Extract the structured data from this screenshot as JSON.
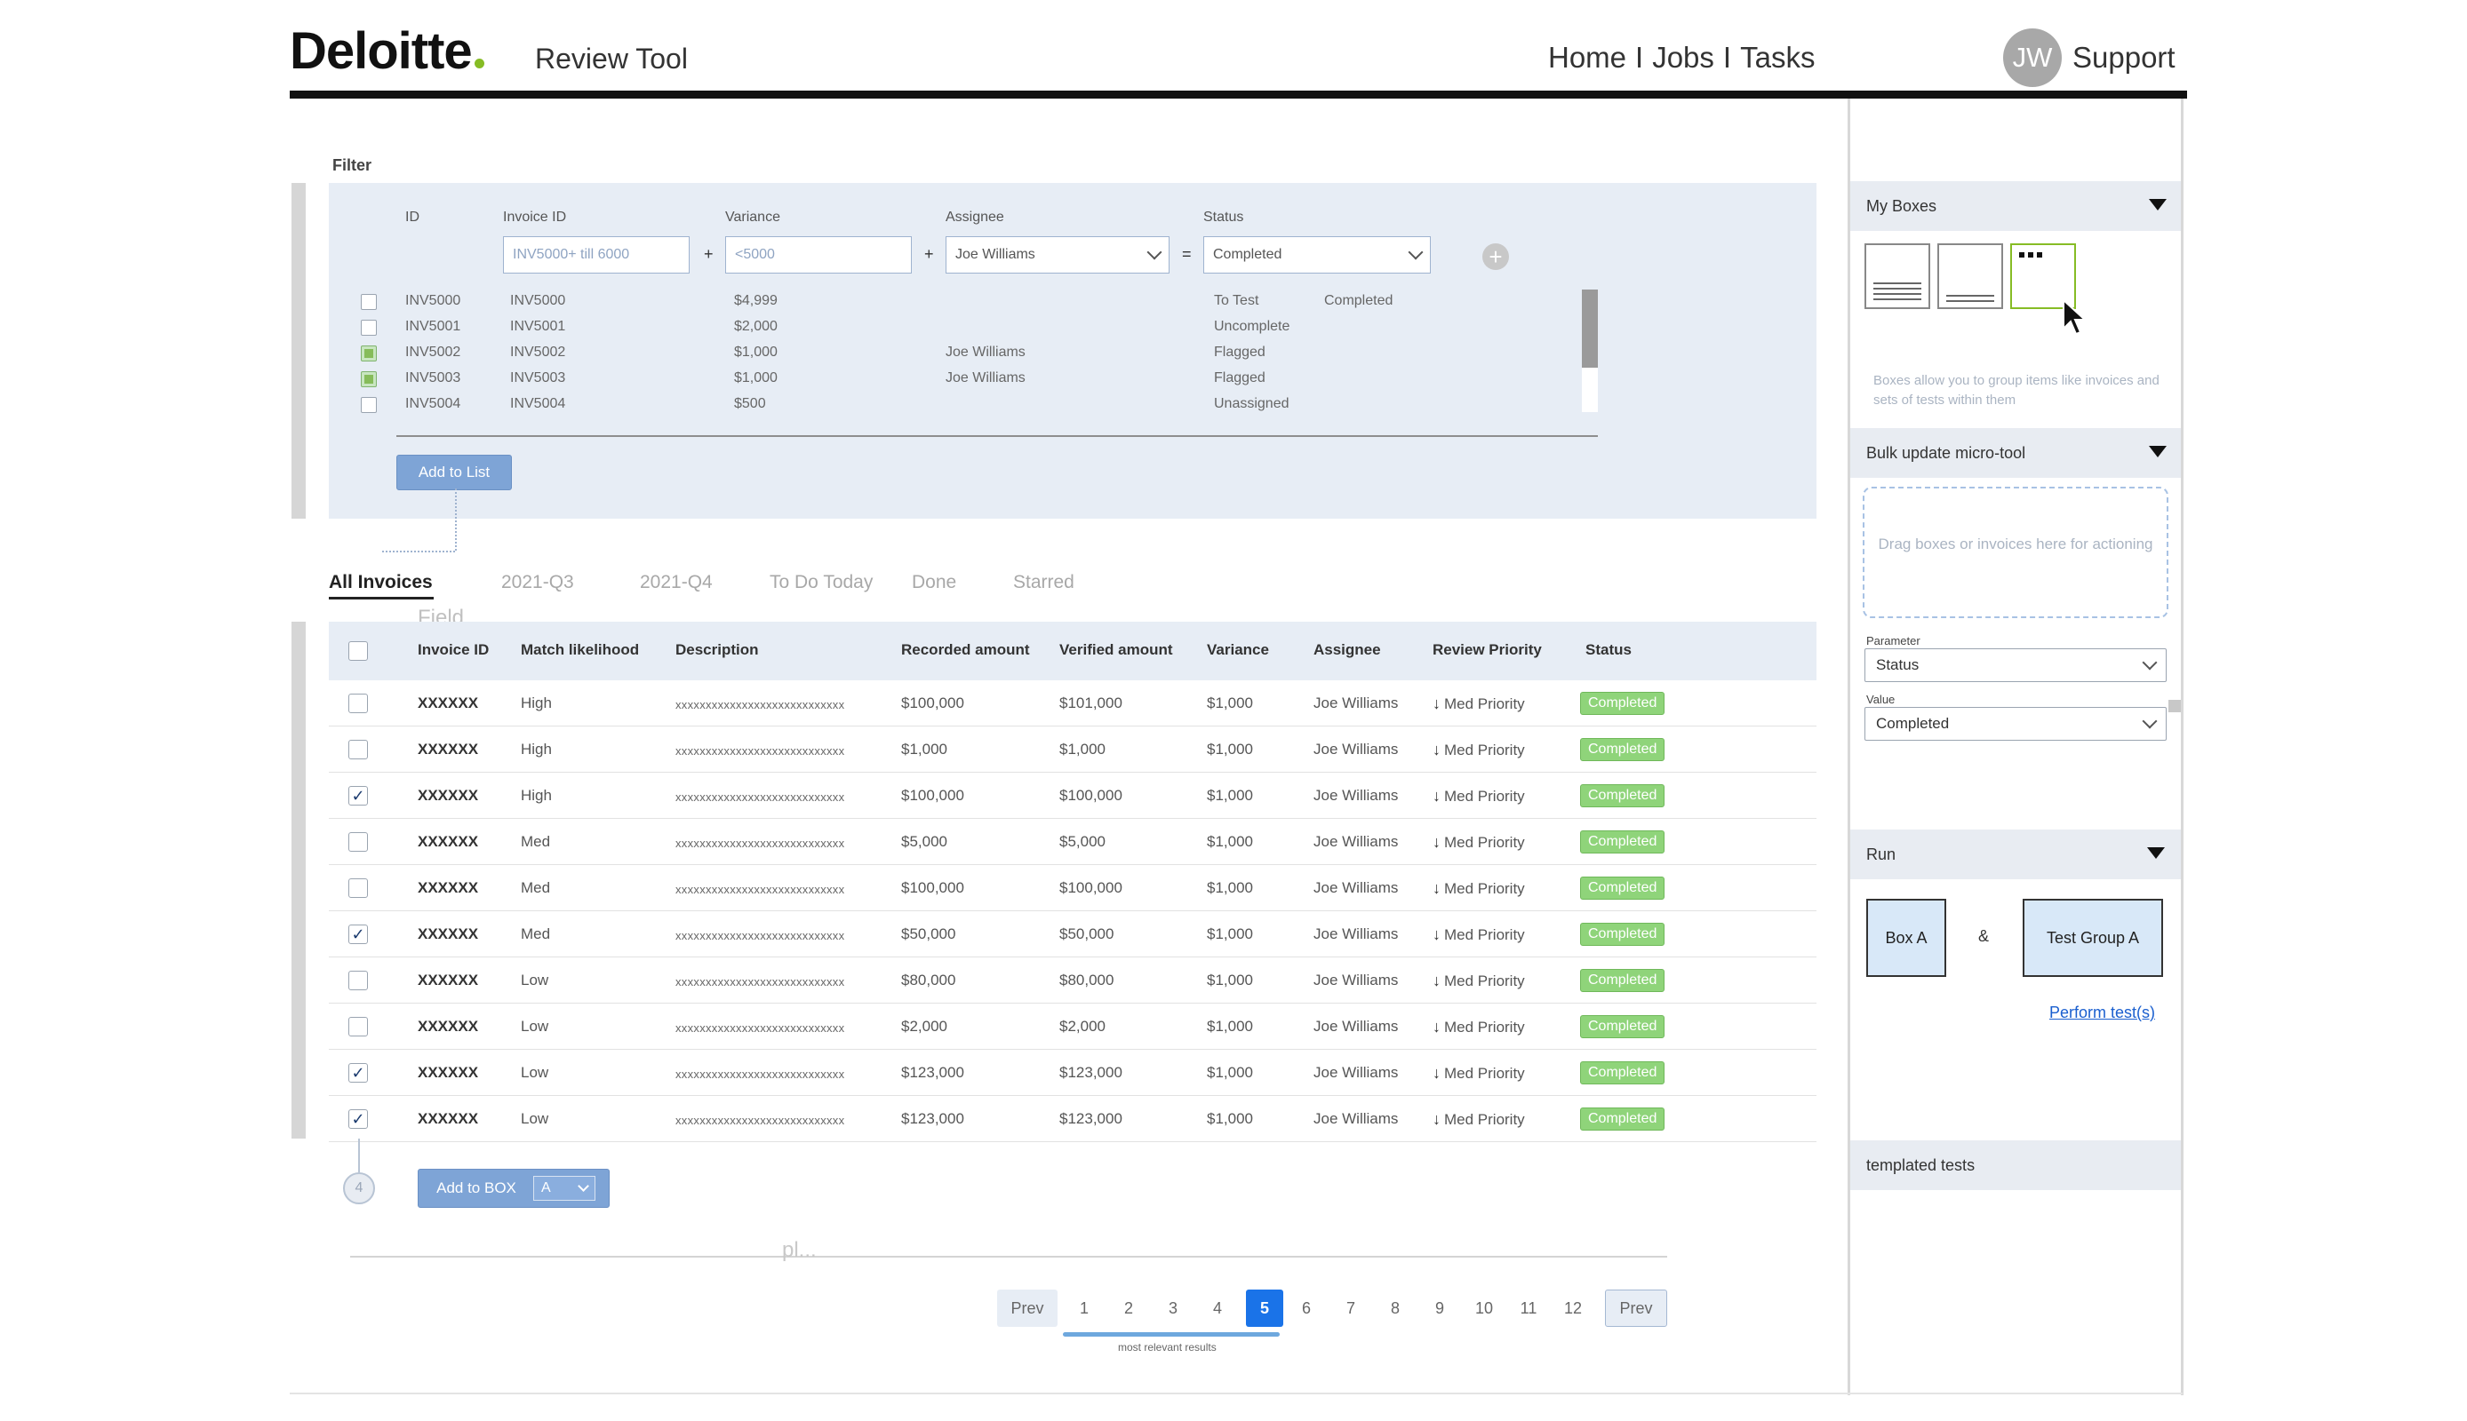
{
  "header": {
    "logo": "Deloitte",
    "app_title": "Review Tool",
    "nav": [
      "Home",
      "Jobs",
      "Tasks"
    ],
    "nav_sep": "I",
    "avatar_initials": "JW",
    "support": "Support",
    "accent_color": "#86bc25"
  },
  "filter": {
    "label": "Filter",
    "columns": {
      "id": "ID",
      "invoice_id": "Invoice ID",
      "variance": "Variance",
      "assignee": "Assignee",
      "status": "Status"
    },
    "inputs": {
      "invoice_id_placeholder": "INV5000+ till 6000",
      "variance_placeholder": "<5000",
      "assignee_value": "Joe Williams",
      "status_value": "Completed"
    },
    "ops": [
      "+",
      "+",
      "="
    ],
    "add_icon": "plus-circle-icon",
    "rows": [
      {
        "id": "INV5000",
        "invoice": "INV5000",
        "variance": "$4,999",
        "assignee": "",
        "status": "To Test",
        "extra": "Completed",
        "checked": false
      },
      {
        "id": "INV5001",
        "invoice": "INV5001",
        "variance": "$2,000",
        "assignee": "",
        "status": "Uncomplete",
        "extra": "",
        "checked": false
      },
      {
        "id": "INV5002",
        "invoice": "INV5002",
        "variance": "$1,000",
        "assignee": "Joe Williams",
        "status": "Flagged",
        "extra": "",
        "checked": true
      },
      {
        "id": "INV5003",
        "invoice": "INV5003",
        "variance": "$1,000",
        "assignee": "Joe Williams",
        "status": "Flagged",
        "extra": "",
        "checked": true
      },
      {
        "id": "INV5004",
        "invoice": "INV5004",
        "variance": "$500",
        "assignee": "",
        "status": "Unassigned",
        "extra": "",
        "checked": false
      }
    ],
    "add_button": "Add to List"
  },
  "tabs": [
    "All Invoices",
    "2021-Q3",
    "2021-Q4",
    "To Do Today",
    "Done",
    "Starred"
  ],
  "ghost_field": "Field",
  "table": {
    "headers": [
      "Invoice ID",
      "Match likelihood",
      "Description",
      "Recorded amount",
      "Verified amount",
      "Variance",
      "Assignee",
      "Review Priority",
      "Status"
    ],
    "rows": [
      {
        "id": "XXXXXX",
        "match": "High",
        "desc": "xxxxxxxxxxxxxxxxxxxxxxxxxxxx",
        "recorded": "$100,000",
        "verified": "$101,000",
        "variance": "$1,000",
        "assignee": "Joe Williams",
        "priority": "Med Priority",
        "status": "Completed",
        "checked": false
      },
      {
        "id": "XXXXXX",
        "match": "High",
        "desc": "xxxxxxxxxxxxxxxxxxxxxxxxxxxx",
        "recorded": "$1,000",
        "verified": "$1,000",
        "variance": "$1,000",
        "assignee": "Joe Williams",
        "priority": "Med Priority",
        "status": "Completed",
        "checked": false
      },
      {
        "id": "XXXXXX",
        "match": "High",
        "desc": "xxxxxxxxxxxxxxxxxxxxxxxxxxxx",
        "recorded": "$100,000",
        "verified": "$100,000",
        "variance": "$1,000",
        "assignee": "Joe Williams",
        "priority": "Med Priority",
        "status": "Completed",
        "checked": true
      },
      {
        "id": "XXXXXX",
        "match": "Med",
        "desc": "xxxxxxxxxxxxxxxxxxxxxxxxxxxx",
        "recorded": "$5,000",
        "verified": "$5,000",
        "variance": "$1,000",
        "assignee": "Joe Williams",
        "priority": "Med Priority",
        "status": "Completed",
        "checked": false
      },
      {
        "id": "XXXXXX",
        "match": "Med",
        "desc": "xxxxxxxxxxxxxxxxxxxxxxxxxxxx",
        "recorded": "$100,000",
        "verified": "$100,000",
        "variance": "$1,000",
        "assignee": "Joe Williams",
        "priority": "Med Priority",
        "status": "Completed",
        "checked": false
      },
      {
        "id": "XXXXXX",
        "match": "Med",
        "desc": "xxxxxxxxxxxxxxxxxxxxxxxxxxxx",
        "recorded": "$50,000",
        "verified": "$50,000",
        "variance": "$1,000",
        "assignee": "Joe Williams",
        "priority": "Med Priority",
        "status": "Completed",
        "checked": true
      },
      {
        "id": "XXXXXX",
        "match": "Low",
        "desc": "xxxxxxxxxxxxxxxxxxxxxxxxxxxx",
        "recorded": "$80,000",
        "verified": "$80,000",
        "variance": "$1,000",
        "assignee": "Joe Williams",
        "priority": "Med Priority",
        "status": "Completed",
        "checked": false
      },
      {
        "id": "XXXXXX",
        "match": "Low",
        "desc": "xxxxxxxxxxxxxxxxxxxxxxxxxxxx",
        "recorded": "$2,000",
        "verified": "$2,000",
        "variance": "$1,000",
        "assignee": "Joe Williams",
        "priority": "Med Priority",
        "status": "Completed",
        "checked": false
      },
      {
        "id": "XXXXXX",
        "match": "Low",
        "desc": "xxxxxxxxxxxxxxxxxxxxxxxxxxxx",
        "recorded": "$123,000",
        "verified": "$123,000",
        "variance": "$1,000",
        "assignee": "Joe Williams",
        "priority": "Med Priority",
        "status": "Completed",
        "checked": true
      },
      {
        "id": "XXXXXX",
        "match": "Low",
        "desc": "xxxxxxxxxxxxxxxxxxxxxxxxxxxx",
        "recorded": "$123,000",
        "verified": "$123,000",
        "variance": "$1,000",
        "assignee": "Joe Williams",
        "priority": "Med Priority",
        "status": "Completed",
        "checked": true
      }
    ],
    "status_color": "#8fd47a"
  },
  "below_table": {
    "step_number": "4",
    "add_to_box": "Add to BOX",
    "box_value": "A",
    "ghost_text": "pl..."
  },
  "pagination": {
    "prev": "Prev",
    "pages": [
      "1",
      "2",
      "3",
      "4",
      "5",
      "6",
      "7",
      "8",
      "9",
      "10",
      "11",
      "12"
    ],
    "current": "5",
    "next": "Prev",
    "note": "most relevant results"
  },
  "right_panel": {
    "my_boxes": "My Boxes",
    "boxes_hint": "Boxes allow you to group items like invoices and sets of tests within them",
    "bulk_update": "Bulk update micro-tool",
    "dropzone_text": "Drag boxes or invoices here for actioning",
    "parameter_label": "Parameter",
    "parameter_value": "Status",
    "value_label": "Value",
    "value_value": "Completed",
    "run": "Run",
    "box_a": "Box A",
    "amp": "&",
    "test_group": "Test Group A",
    "perform": "Perform test(s)",
    "templated": "templated tests"
  }
}
